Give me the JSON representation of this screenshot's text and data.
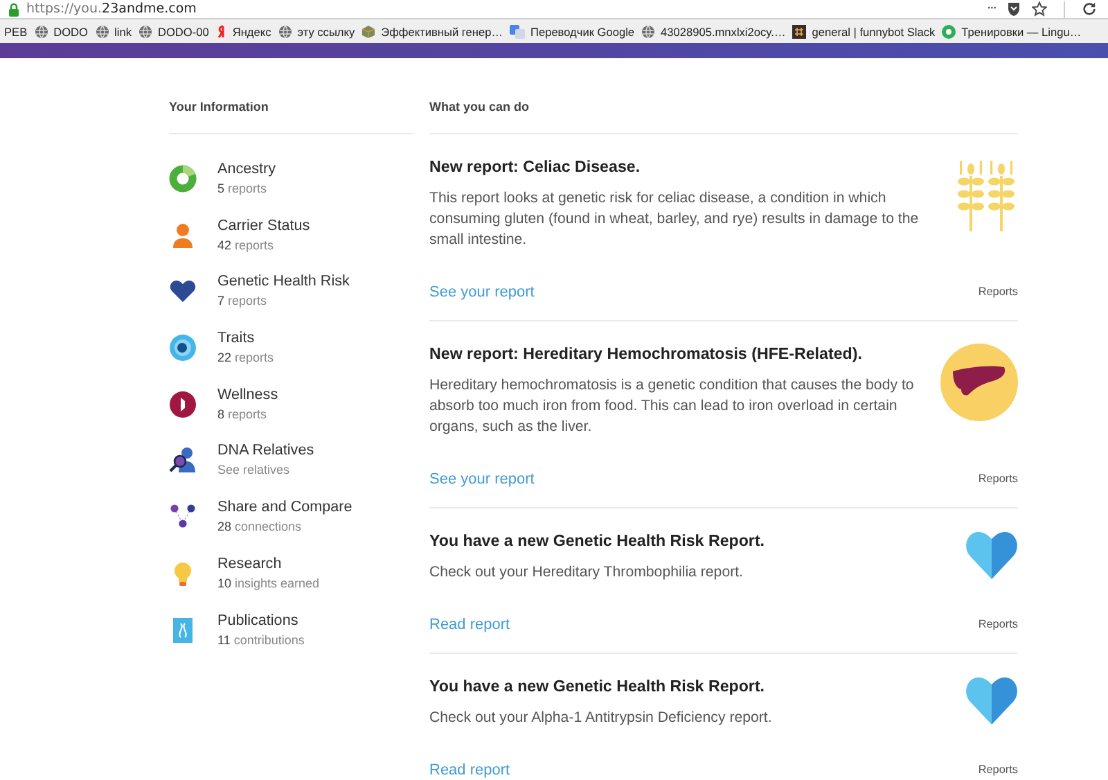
{
  "browser": {
    "url_prefix": "https://you.",
    "url_domain": "23andme.com",
    "menu": "···",
    "bookmarks": [
      {
        "label": "РЕВ"
      },
      {
        "label": "DODO",
        "kind": "globe"
      },
      {
        "label": "link",
        "kind": "globe"
      },
      {
        "label": "DODO-00",
        "kind": "globe"
      },
      {
        "label": "Яндекс",
        "kind": "yandex"
      },
      {
        "label": "эту ссылку",
        "kind": "globe"
      },
      {
        "label": "Эффективный генер…",
        "kind": "cube"
      },
      {
        "label": "Переводчик Google",
        "kind": "translate"
      },
      {
        "label": "43028905.mnxlxi2ocy.…",
        "kind": "globe"
      },
      {
        "label": "general | funnybot Slack",
        "kind": "slack"
      },
      {
        "label": "Тренировки — Lingu…",
        "kind": "lingua"
      }
    ]
  },
  "sidebar": {
    "title": "Your Information",
    "items": [
      {
        "kind": "ancestry",
        "title": "Ancestry",
        "subtitle": "**5** reports"
      },
      {
        "kind": "carrier",
        "title": "Carrier Status",
        "subtitle": "**42** reports"
      },
      {
        "kind": "health",
        "title": "Genetic Health Risk",
        "subtitle": "**7** reports"
      },
      {
        "kind": "traits",
        "title": "Traits",
        "subtitle": "**22** reports"
      },
      {
        "kind": "wellness",
        "title": "Wellness",
        "subtitle": "**8** reports"
      },
      {
        "kind": "relatives",
        "title": "DNA Relatives",
        "subtitle": "See relatives"
      },
      {
        "kind": "share",
        "title": "Share and Compare",
        "subtitle": "**28** connections"
      },
      {
        "kind": "research",
        "title": "Research",
        "subtitle": "**10** insights earned"
      },
      {
        "kind": "publications",
        "title": "Publications",
        "subtitle": "**11** contributions"
      }
    ]
  },
  "feed": {
    "title": "What you can do",
    "cards": [
      {
        "kind": "wheat",
        "title": "New report: Celiac Disease.",
        "body": "This report looks at genetic risk for celiac disease, a condition in which consuming gluten (found in wheat, barley, and rye) results in damage to the small intestine.",
        "link": "See your report",
        "tag": "Reports"
      },
      {
        "kind": "liver",
        "title": "New report: Hereditary Hemochromatosis (HFE-Related).",
        "body": "Hereditary hemochromatosis is a genetic condition that causes the body to absorb too much iron from food. This can lead to iron overload in certain organs, such as the liver.",
        "link": "See your report",
        "tag": "Reports"
      },
      {
        "kind": "heart",
        "title": "You have a new Genetic Health Risk Report.",
        "body": "Check out your Hereditary Thrombophilia report.",
        "link": "Read report",
        "tag": "Reports"
      },
      {
        "kind": "heart",
        "title": "You have a new Genetic Health Risk Report.",
        "body": "Check out your Alpha-1 Antitrypsin Deficiency report.",
        "link": "Read report",
        "tag": "Reports"
      }
    ]
  }
}
